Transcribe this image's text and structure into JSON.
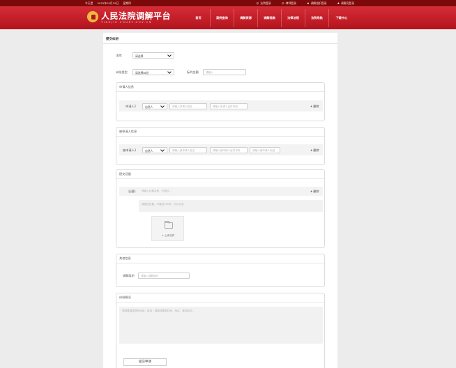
{
  "topbar": {
    "day": "今天是",
    "date": "2025年05月29日",
    "weekday": "星期四",
    "links": [
      {
        "icon": "user-icon",
        "glyph": "☺",
        "label": "法院登录"
      },
      {
        "icon": "user-icon",
        "glyph": "☺",
        "label": "律师登录"
      },
      {
        "icon": "user-icon",
        "glyph": "♟",
        "label": "调解组织登录"
      },
      {
        "icon": "user-icon",
        "glyph": "♟",
        "label": "调解员登录"
      }
    ]
  },
  "header": {
    "title": "人民法院调解平台",
    "subtitle": "TIAOJIE.COURT.GOV.CN",
    "nav": [
      "首页",
      "案例查询",
      "调解资源",
      "调解指南",
      "法律法规",
      "法院导航",
      "下载中心"
    ]
  },
  "form": {
    "title": "提交纠纷",
    "court_label": "法院",
    "court_value": "请选择",
    "type_label": "纠纷类型",
    "type_value": "请选择纠纷",
    "amount_label": "标的金额",
    "amount_placeholder": "请输入",
    "applicant": {
      "title": "申请人信息",
      "label": "申请人1",
      "identity_value": "自然人",
      "name_placeholder": "请输入申请人姓名",
      "id_placeholder": "请输入申请人证件号码",
      "delete_label": "删除"
    },
    "respondent": {
      "title": "被申请人信息",
      "label": "被申请人1",
      "identity_value": "自然人",
      "name_placeholder": "请输入被申请人姓名",
      "id_placeholder": "请输入被申请人证件号码",
      "phone_placeholder": "请输入被申请人电话",
      "delete_label": "删除"
    },
    "evidence": {
      "title": "提交证据",
      "label": "证据1",
      "name_placeholder": "请输入证据名称，不超过...",
      "desc_placeholder": "请描述证据，不超过200字，可以为空",
      "upload_label": "上传文件",
      "delete_label": "删除"
    },
    "other": {
      "title": "其他信息",
      "org_label": "调解组织",
      "org_placeholder": "请输入调解组织"
    },
    "summary": {
      "title": "纠纷概况",
      "placeholder": "请简要描述您的纠纷，包括：请描述事发时间、地点、事件经过。"
    },
    "submit_label": "提交申请"
  }
}
